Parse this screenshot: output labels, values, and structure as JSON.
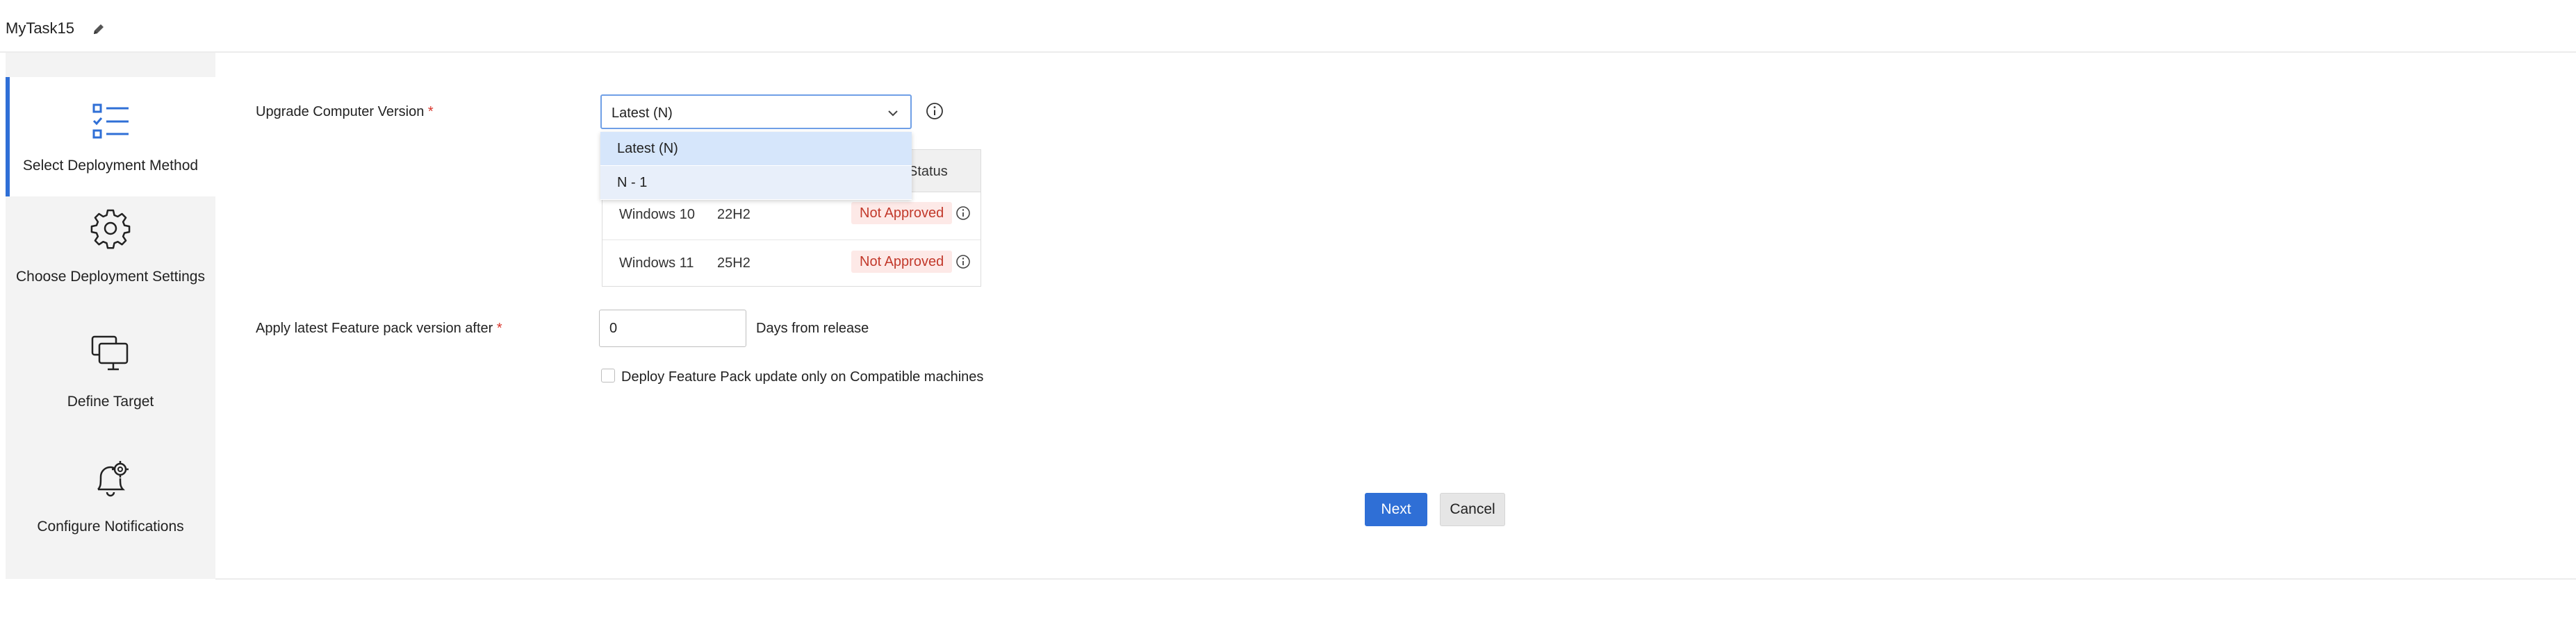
{
  "header": {
    "task_name": "MyTask15"
  },
  "steps": [
    {
      "label": "Select Deployment Method",
      "icon": "checklist-icon",
      "active": true
    },
    {
      "label": "Choose Deployment Settings",
      "icon": "gear-icon",
      "active": false
    },
    {
      "label": "Define Target",
      "icon": "monitors-icon",
      "active": false
    },
    {
      "label": "Configure Notifications",
      "icon": "bell-gear-icon",
      "active": false
    }
  ],
  "form": {
    "upgrade_label": "Upgrade Computer Version",
    "required_mark": "*",
    "upgrade_selected": "Latest (N)",
    "upgrade_options": [
      "Latest (N)",
      "N - 1"
    ],
    "feature_pack_label": "Apply latest Feature pack version after",
    "days_value": "0",
    "days_suffix": "Days from release",
    "compatible_label": "Deploy Feature Pack update only on Compatible machines"
  },
  "table": {
    "status_header": "Status",
    "rows": [
      {
        "os": "Windows 10",
        "version": "22H2",
        "status": "Not Approved"
      },
      {
        "os": "Windows 11",
        "version": "25H2",
        "status": "Not Approved"
      }
    ]
  },
  "buttons": {
    "next": "Next",
    "cancel": "Cancel"
  },
  "colors": {
    "accent": "#2f6fd6",
    "required": "#d9342b",
    "badge_text": "#c2392b",
    "badge_bg": "#fde9e7"
  }
}
